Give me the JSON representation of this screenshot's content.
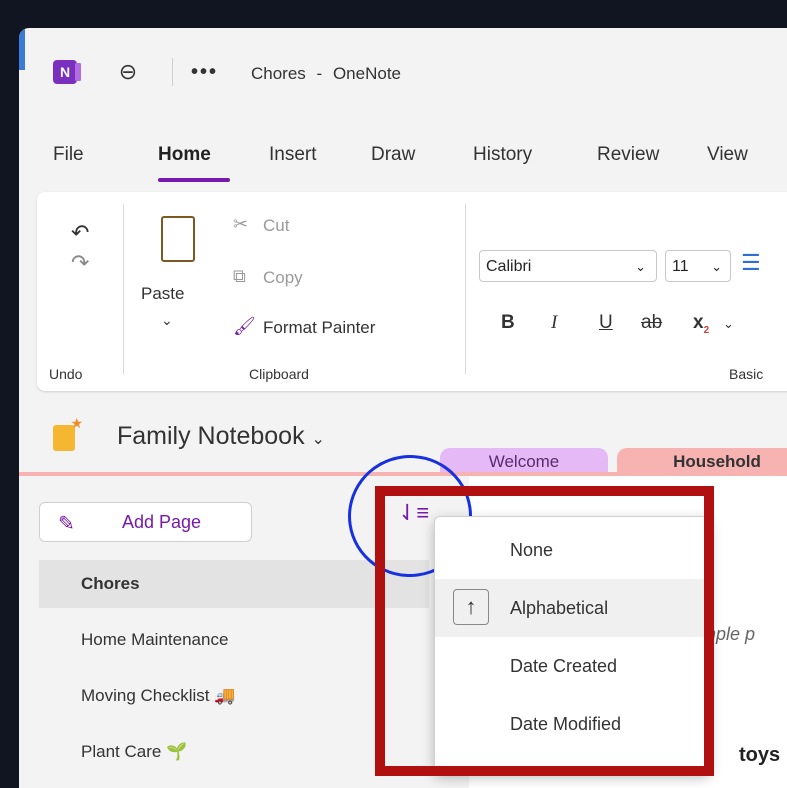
{
  "window": {
    "title": "Chores",
    "separator": "-",
    "app_name": "OneNote",
    "app_icon_letter": "N",
    "back_glyph": "⊖",
    "more_glyph": "•••"
  },
  "menu": {
    "items": [
      "File",
      "Home",
      "Insert",
      "Draw",
      "History",
      "Review",
      "View"
    ],
    "active": "Home"
  },
  "ribbon": {
    "undo_label": "Undo",
    "clipboard": {
      "paste": "Paste",
      "cut": "Cut",
      "copy": "Copy",
      "format_painter": "Format Painter",
      "group_label": "Clipboard"
    },
    "font": {
      "family": "Calibri",
      "size": "11",
      "bold": "B",
      "italic": "I",
      "underline": "U",
      "strike": "ab",
      "subscript": "x",
      "group_label": "Basic"
    }
  },
  "notebook": {
    "name": "Family Notebook",
    "tabs": [
      {
        "label": "Welcome",
        "color": "#e4b9f5"
      },
      {
        "label": "Household",
        "color": "#f7b2b2"
      }
    ]
  },
  "pages": {
    "add_page": "Add Page",
    "items": [
      {
        "label": "Chores",
        "selected": true
      },
      {
        "label": "Home Maintenance",
        "selected": false
      },
      {
        "label": "Moving Checklist 🚚",
        "selected": false
      },
      {
        "label": "Plant Care 🌱",
        "selected": false
      }
    ]
  },
  "note": {
    "partial_text": "mple p",
    "todo_text": "toys"
  },
  "sort_menu": {
    "options": [
      {
        "label": "None",
        "checked": false
      },
      {
        "label": "Alphabetical",
        "checked": true
      },
      {
        "label": "Date Created",
        "checked": false
      },
      {
        "label": "Date Modified",
        "checked": false
      }
    ],
    "check_glyph": "↑"
  },
  "colors": {
    "accent": "#7719aa",
    "annotation_circle": "#1730e0",
    "annotation_frame": "#b01010"
  }
}
